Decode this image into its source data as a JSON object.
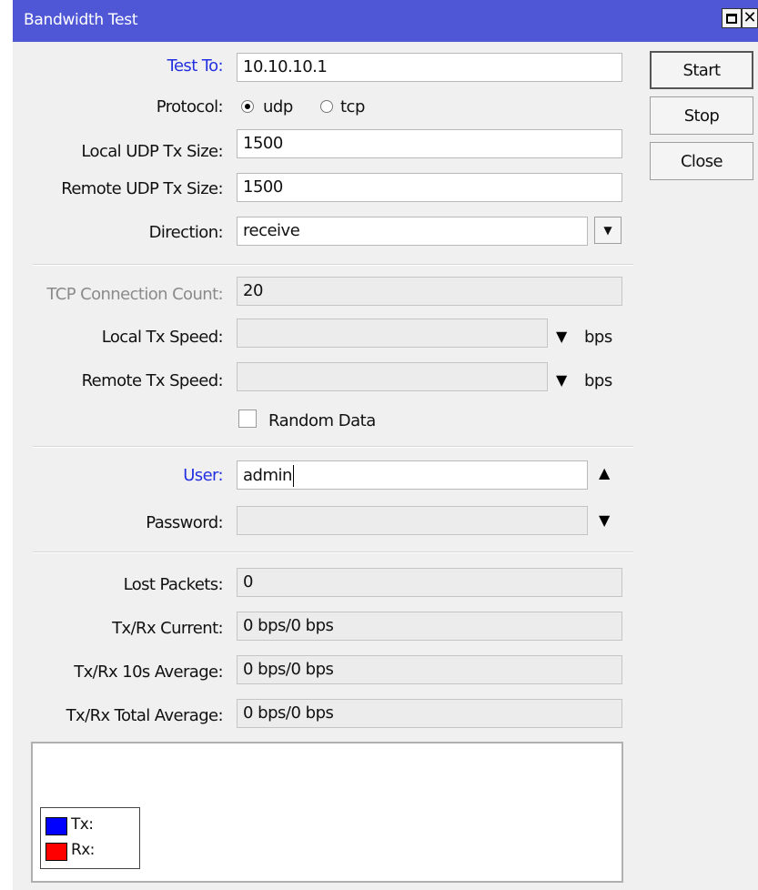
{
  "window": {
    "title": "Bandwidth Test"
  },
  "buttons": {
    "start": "Start",
    "stop": "Stop",
    "close": "Close"
  },
  "form": {
    "test_to": {
      "label": "Test To:",
      "value": "10.10.10.1"
    },
    "protocol": {
      "label": "Protocol:",
      "options": [
        "udp",
        "tcp"
      ],
      "selected": "udp"
    },
    "local_udp_tx_size": {
      "label": "Local UDP Tx Size:",
      "value": "1500"
    },
    "remote_udp_tx_size": {
      "label": "Remote UDP Tx Size:",
      "value": "1500"
    },
    "direction": {
      "label": "Direction:",
      "value": "receive"
    },
    "tcp_connection_count": {
      "label": "TCP Connection Count:",
      "value": "20"
    },
    "local_tx_speed": {
      "label": "Local Tx Speed:",
      "value": "",
      "unit": "bps"
    },
    "remote_tx_speed": {
      "label": "Remote Tx Speed:",
      "value": "",
      "unit": "bps"
    },
    "random_data": {
      "label": "Random Data",
      "checked": false
    },
    "user": {
      "label": "User:",
      "value": "admin"
    },
    "password": {
      "label": "Password:",
      "value": ""
    }
  },
  "stats": {
    "lost_packets": {
      "label": "Lost Packets:",
      "value": "0"
    },
    "tx_rx_current": {
      "label": "Tx/Rx Current:",
      "value": "0 bps/0 bps"
    },
    "tx_rx_10s_average": {
      "label": "Tx/Rx 10s Average:",
      "value": "0 bps/0 bps"
    },
    "tx_rx_total_average": {
      "label": "Tx/Rx Total Average:",
      "value": "0 bps/0 bps"
    }
  },
  "graph": {
    "legend": [
      {
        "label": "Tx:",
        "color": "#0000ff"
      },
      {
        "label": "Rx:",
        "color": "#ff0000"
      }
    ]
  },
  "icons": {
    "maximize": "maximize-icon",
    "close": "close-icon",
    "dropdown": "dropdown-arrow-icon",
    "collapse": "triangle-up-icon",
    "expand": "triangle-down-icon"
  }
}
